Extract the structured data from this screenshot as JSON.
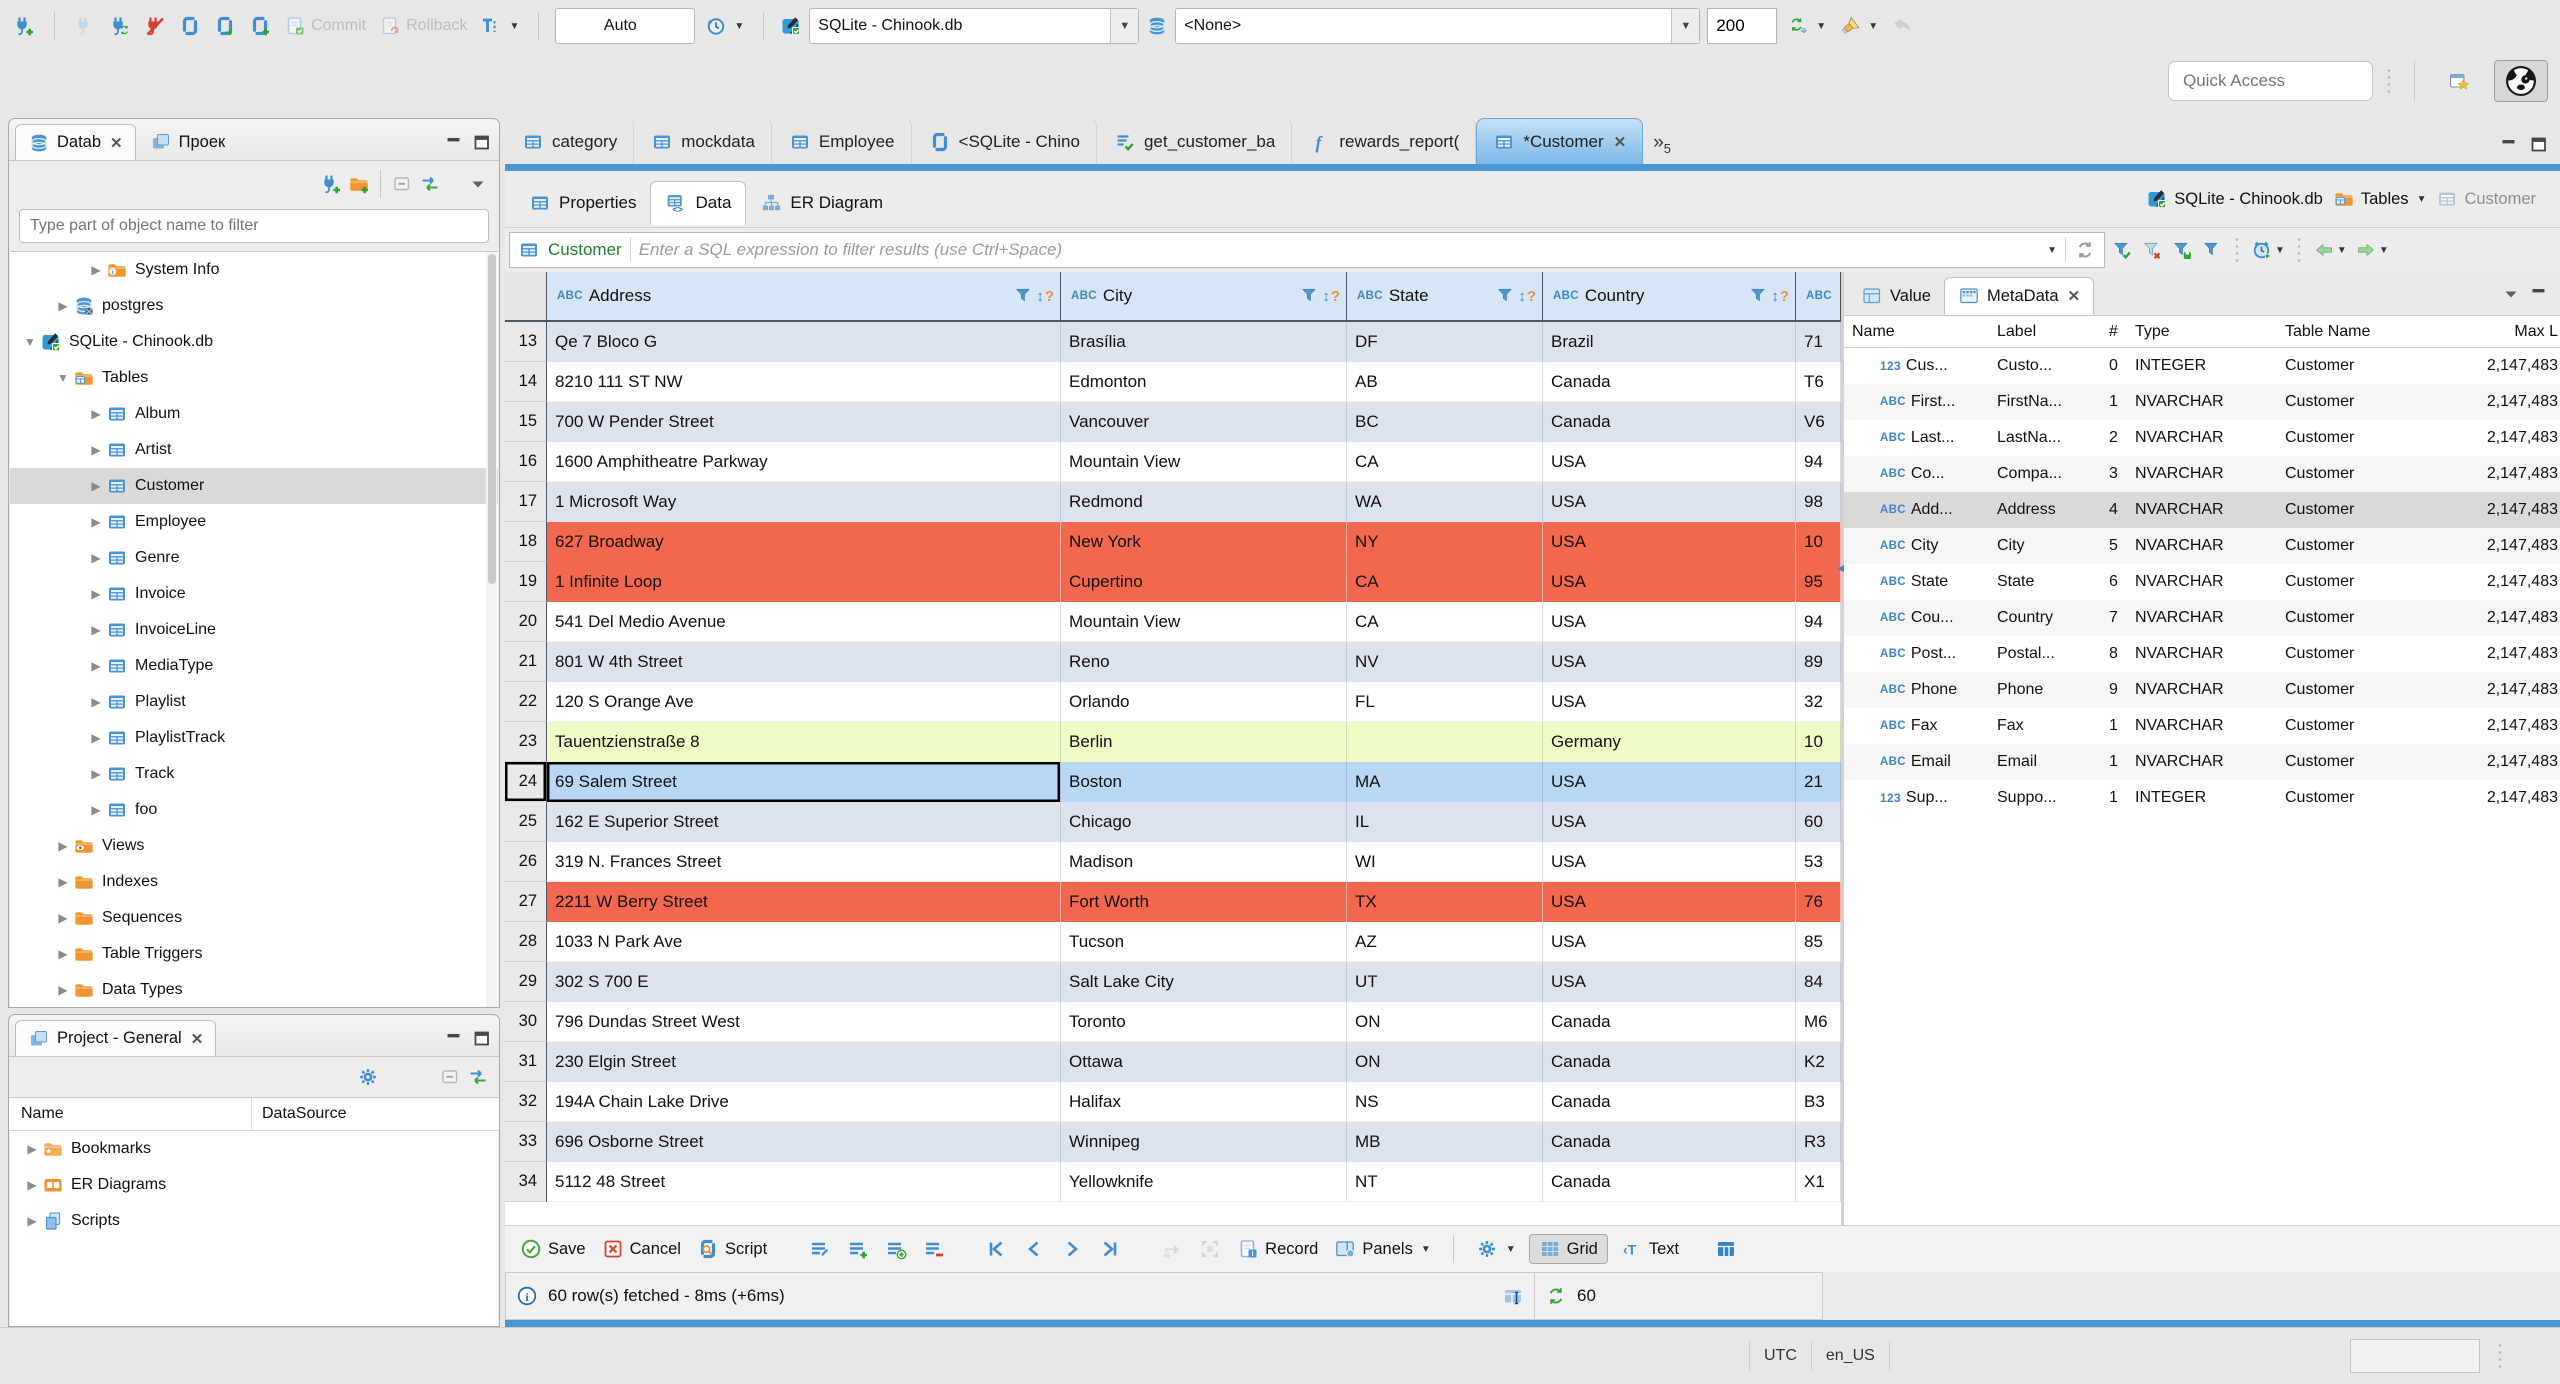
{
  "toolbar": {
    "commit": "Commit",
    "rollback": "Rollback",
    "auto": "Auto",
    "connection": "SQLite - Chinook.db",
    "schema": "<None>",
    "fetch_size": "200",
    "quick_access_placeholder": "Quick Access"
  },
  "navigator": {
    "tab": "Datab",
    "tab2": "Проек",
    "filter_placeholder": "Type part of object name to filter",
    "tree": [
      {
        "label": "System Info",
        "icon": "folder-info",
        "level": 2,
        "arrow": "collapsed"
      },
      {
        "label": "postgres",
        "icon": "db-postgres",
        "level": 1,
        "arrow": "collapsed"
      },
      {
        "label": "SQLite - Chinook.db",
        "icon": "sqlite-db",
        "level": 0,
        "arrow": "expanded"
      },
      {
        "label": "Tables",
        "icon": "folder-tables",
        "level": 1,
        "arrow": "expanded"
      },
      {
        "label": "Album",
        "icon": "table",
        "level": 2,
        "arrow": "collapsed"
      },
      {
        "label": "Artist",
        "icon": "table",
        "level": 2,
        "arrow": "collapsed"
      },
      {
        "label": "Customer",
        "icon": "table",
        "level": 2,
        "arrow": "collapsed",
        "selected": true
      },
      {
        "label": "Employee",
        "icon": "table",
        "level": 2,
        "arrow": "collapsed"
      },
      {
        "label": "Genre",
        "icon": "table",
        "level": 2,
        "arrow": "collapsed"
      },
      {
        "label": "Invoice",
        "icon": "table",
        "level": 2,
        "arrow": "collapsed"
      },
      {
        "label": "InvoiceLine",
        "icon": "table",
        "level": 2,
        "arrow": "collapsed"
      },
      {
        "label": "MediaType",
        "icon": "table",
        "level": 2,
        "arrow": "collapsed"
      },
      {
        "label": "Playlist",
        "icon": "table",
        "level": 2,
        "arrow": "collapsed"
      },
      {
        "label": "PlaylistTrack",
        "icon": "table",
        "level": 2,
        "arrow": "collapsed"
      },
      {
        "label": "Track",
        "icon": "table",
        "level": 2,
        "arrow": "collapsed"
      },
      {
        "label": "foo",
        "icon": "table",
        "level": 2,
        "arrow": "collapsed"
      },
      {
        "label": "Views",
        "icon": "folder-views",
        "level": 1,
        "arrow": "collapsed"
      },
      {
        "label": "Indexes",
        "icon": "folder",
        "level": 1,
        "arrow": "collapsed"
      },
      {
        "label": "Sequences",
        "icon": "folder",
        "level": 1,
        "arrow": "collapsed"
      },
      {
        "label": "Table Triggers",
        "icon": "folder",
        "level": 1,
        "arrow": "collapsed"
      },
      {
        "label": "Data Types",
        "icon": "folder",
        "level": 1,
        "arrow": "collapsed"
      }
    ]
  },
  "project": {
    "tab": "Project - General",
    "columns": [
      "Name",
      "DataSource"
    ],
    "items": [
      {
        "label": "Bookmarks",
        "icon": "folder-bookmarks"
      },
      {
        "label": "ER Diagrams",
        "icon": "er-diagrams"
      },
      {
        "label": "Scripts",
        "icon": "scripts"
      }
    ]
  },
  "editor": {
    "tabs": [
      {
        "label": "category",
        "icon": "table"
      },
      {
        "label": "mockdata",
        "icon": "table"
      },
      {
        "label": "Employee",
        "icon": "table"
      },
      {
        "label": "<SQLite - Chino",
        "icon": "sql-file"
      },
      {
        "label": "get_customer_ba",
        "icon": "sql-file-check"
      },
      {
        "label": "rewards_report(",
        "icon": "function-f"
      },
      {
        "label": "*Customer",
        "icon": "table",
        "active": true,
        "closable": true
      }
    ],
    "overflow_count": "5",
    "result_tabs": [
      {
        "label": "Properties",
        "icon": "table"
      },
      {
        "label": "Data",
        "icon": "table-data",
        "active": true
      },
      {
        "label": "ER Diagram",
        "icon": "er-diagram-tab"
      }
    ],
    "breadcrumb": [
      {
        "label": "SQLite - Chinook.db",
        "icon": "sqlite-db"
      },
      {
        "label": "Tables",
        "icon": "folder-tables",
        "dropdown": true
      },
      {
        "label": "Customer",
        "icon": "table-muted",
        "muted": true
      }
    ]
  },
  "filter": {
    "table": "Customer",
    "placeholder": "Enter a SQL expression to filter results (use Ctrl+Space)"
  },
  "grid": {
    "columns": [
      "Address",
      "City",
      "State",
      "Country",
      ""
    ],
    "rows": [
      {
        "num": "13",
        "cells": [
          "Qe 7 Bloco G",
          "Brasília",
          "DF",
          "Brazil",
          "71"
        ],
        "style": "alt"
      },
      {
        "num": "14",
        "cells": [
          "8210 111 ST NW",
          "Edmonton",
          "AB",
          "Canada",
          "T6"
        ],
        "style": "plain"
      },
      {
        "num": "15",
        "cells": [
          "700 W Pender Street",
          "Vancouver",
          "BC",
          "Canada",
          "V6"
        ],
        "style": "alt"
      },
      {
        "num": "16",
        "cells": [
          "1600 Amphitheatre Parkway",
          "Mountain View",
          "CA",
          "USA",
          "94"
        ],
        "style": "plain"
      },
      {
        "num": "17",
        "cells": [
          "1 Microsoft Way",
          "Redmond",
          "WA",
          "USA",
          "98"
        ],
        "style": "alt"
      },
      {
        "num": "18",
        "cells": [
          "627 Broadway",
          "New York",
          "NY",
          "USA",
          "10"
        ],
        "style": "red"
      },
      {
        "num": "19",
        "cells": [
          "1 Infinite Loop",
          "Cupertino",
          "CA",
          "USA",
          "95"
        ],
        "style": "red"
      },
      {
        "num": "20",
        "cells": [
          "541 Del Medio Avenue",
          "Mountain View",
          "CA",
          "USA",
          "94"
        ],
        "style": "plain"
      },
      {
        "num": "21",
        "cells": [
          "801 W 4th Street",
          "Reno",
          "NV",
          "USA",
          "89"
        ],
        "style": "alt"
      },
      {
        "num": "22",
        "cells": [
          "120 S Orange Ave",
          "Orlando",
          "FL",
          "USA",
          "32"
        ],
        "style": "plain"
      },
      {
        "num": "23",
        "cells": [
          "Tauentzienstraße 8",
          "Berlin",
          "",
          "Germany",
          "10"
        ],
        "style": "green"
      },
      {
        "num": "24",
        "cells": [
          "69 Salem Street",
          "Boston",
          "MA",
          "USA",
          "21"
        ],
        "style": "sel",
        "focused": true
      },
      {
        "num": "25",
        "cells": [
          "162 E Superior Street",
          "Chicago",
          "IL",
          "USA",
          "60"
        ],
        "style": "alt"
      },
      {
        "num": "26",
        "cells": [
          "319 N. Frances Street",
          "Madison",
          "WI",
          "USA",
          "53"
        ],
        "style": "plain"
      },
      {
        "num": "27",
        "cells": [
          "2211 W Berry Street",
          "Fort Worth",
          "TX",
          "USA",
          "76"
        ],
        "style": "red"
      },
      {
        "num": "28",
        "cells": [
          "1033 N Park Ave",
          "Tucson",
          "AZ",
          "USA",
          "85"
        ],
        "style": "plain"
      },
      {
        "num": "29",
        "cells": [
          "302 S 700 E",
          "Salt Lake City",
          "UT",
          "USA",
          "84"
        ],
        "style": "alt"
      },
      {
        "num": "30",
        "cells": [
          "796 Dundas Street West",
          "Toronto",
          "ON",
          "Canada",
          "M6"
        ],
        "style": "plain"
      },
      {
        "num": "31",
        "cells": [
          "230 Elgin Street",
          "Ottawa",
          "ON",
          "Canada",
          "K2"
        ],
        "style": "alt"
      },
      {
        "num": "32",
        "cells": [
          "194A Chain Lake Drive",
          "Halifax",
          "NS",
          "Canada",
          "B3"
        ],
        "style": "plain"
      },
      {
        "num": "33",
        "cells": [
          "696 Osborne Street",
          "Winnipeg",
          "MB",
          "Canada",
          "R3"
        ],
        "style": "alt"
      },
      {
        "num": "34",
        "cells": [
          "5112 48 Street",
          "Yellowknife",
          "NT",
          "Canada",
          "X1"
        ],
        "style": "plain"
      }
    ]
  },
  "metadata": {
    "tabs": [
      {
        "label": "Value",
        "icon": "value-panel"
      },
      {
        "label": "MetaData",
        "icon": "metadata-panel",
        "active": true,
        "closable": true
      }
    ],
    "columns": [
      "Name",
      "Label",
      "#",
      "Type",
      "Table Name",
      "Max L"
    ],
    "rows": [
      {
        "kind": "123",
        "name": "Cus...",
        "label": "Custo...",
        "num": "0",
        "type": "INTEGER",
        "table": "Customer",
        "max": "2,147,483"
      },
      {
        "kind": "abc",
        "name": "First...",
        "label": "FirstNa...",
        "num": "1",
        "type": "NVARCHAR",
        "table": "Customer",
        "max": "2,147,483"
      },
      {
        "kind": "abc",
        "name": "Last...",
        "label": "LastNa...",
        "num": "2",
        "type": "NVARCHAR",
        "table": "Customer",
        "max": "2,147,483"
      },
      {
        "kind": "abc",
        "name": "Co...",
        "label": "Compa...",
        "num": "3",
        "type": "NVARCHAR",
        "table": "Customer",
        "max": "2,147,483"
      },
      {
        "kind": "abc",
        "name": "Add...",
        "label": "Address",
        "num": "4",
        "type": "NVARCHAR",
        "table": "Customer",
        "max": "2,147,483",
        "selected": true
      },
      {
        "kind": "abc",
        "name": "City",
        "label": "City",
        "num": "5",
        "type": "NVARCHAR",
        "table": "Customer",
        "max": "2,147,483"
      },
      {
        "kind": "abc",
        "name": "State",
        "label": "State",
        "num": "6",
        "type": "NVARCHAR",
        "table": "Customer",
        "max": "2,147,483"
      },
      {
        "kind": "abc",
        "name": "Cou...",
        "label": "Country",
        "num": "7",
        "type": "NVARCHAR",
        "table": "Customer",
        "max": "2,147,483"
      },
      {
        "kind": "abc",
        "name": "Post...",
        "label": "Postal...",
        "num": "8",
        "type": "NVARCHAR",
        "table": "Customer",
        "max": "2,147,483"
      },
      {
        "kind": "abc",
        "name": "Phone",
        "label": "Phone",
        "num": "9",
        "type": "NVARCHAR",
        "table": "Customer",
        "max": "2,147,483"
      },
      {
        "kind": "abc",
        "name": "Fax",
        "label": "Fax",
        "num": "1",
        "type": "NVARCHAR",
        "table": "Customer",
        "max": "2,147,483"
      },
      {
        "kind": "abc",
        "name": "Email",
        "label": "Email",
        "num": "1",
        "type": "NVARCHAR",
        "table": "Customer",
        "max": "2,147,483"
      },
      {
        "kind": "123",
        "name": "Sup...",
        "label": "Suppo...",
        "num": "1",
        "type": "INTEGER",
        "table": "Customer",
        "max": "2,147,483"
      }
    ]
  },
  "result_toolbar": {
    "save": "Save",
    "cancel": "Cancel",
    "script": "Script",
    "record": "Record",
    "panels": "Panels",
    "grid": "Grid",
    "text": "Text"
  },
  "status": {
    "message": "60 row(s) fetched - 8ms (+6ms)",
    "fetch_count": "60"
  },
  "window_status": {
    "timezone": "UTC",
    "locale": "en_US"
  }
}
